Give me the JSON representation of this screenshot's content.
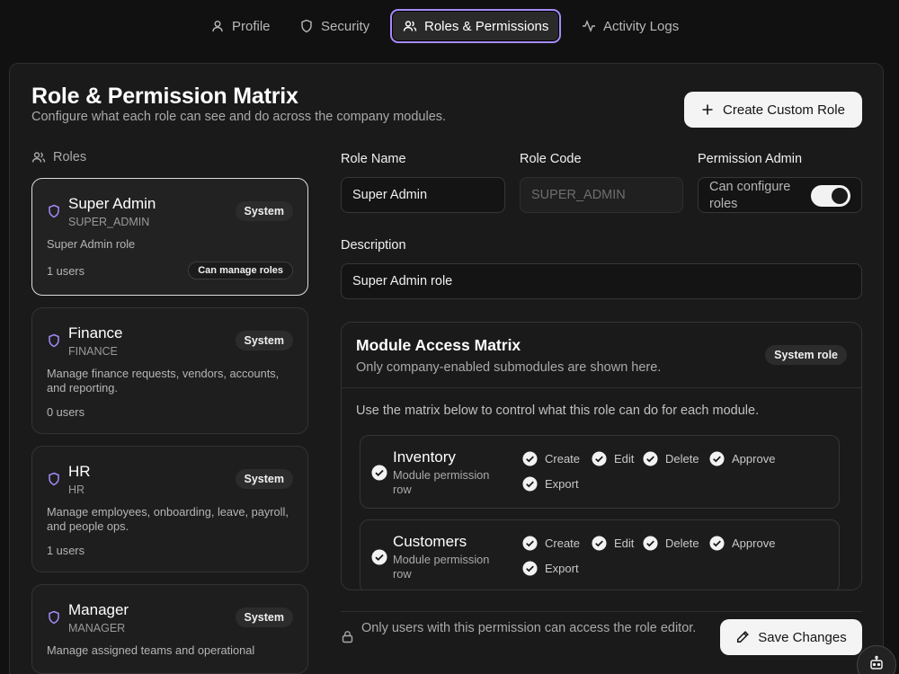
{
  "tabs": [
    {
      "label": "Profile",
      "icon": "user-icon"
    },
    {
      "label": "Security",
      "icon": "shield-icon"
    },
    {
      "label": "Roles & Permissions",
      "icon": "users-icon",
      "active": true
    },
    {
      "label": "Activity Logs",
      "icon": "activity-icon"
    }
  ],
  "header": {
    "title": "Role & Permission Matrix",
    "subtitle": "Configure what each role can see and do across the company modules.",
    "create_label": "Create Custom Role"
  },
  "roles_section": {
    "heading": "Roles",
    "items": [
      {
        "name": "Super Admin",
        "code": "SUPER_ADMIN",
        "badge": "System",
        "description": "Super Admin role",
        "users": "1 users",
        "manage_label": "Can manage roles",
        "selected": true
      },
      {
        "name": "Finance",
        "code": "FINANCE",
        "badge": "System",
        "description": "Manage finance requests, vendors, accounts, and reporting.",
        "users": "0 users"
      },
      {
        "name": "HR",
        "code": "HR",
        "badge": "System",
        "description": "Manage employees, onboarding, leave, payroll, and people ops.",
        "users": "1 users"
      },
      {
        "name": "Manager",
        "code": "MANAGER",
        "badge": "System",
        "description": "Manage assigned teams and operational",
        "users": ""
      }
    ]
  },
  "form": {
    "role_name_label": "Role Name",
    "role_name_value": "Super Admin",
    "role_code_label": "Role Code",
    "role_code_placeholder": "SUPER_ADMIN",
    "permission_admin_label": "Permission Admin",
    "permission_admin_text": "Can configure roles",
    "permission_admin_enabled": true,
    "description_label": "Description",
    "description_value": "Super Admin role"
  },
  "matrix": {
    "title": "Module Access Matrix",
    "subtitle": "Only company-enabled submodules are shown here.",
    "badge": "System role",
    "help": "Use the matrix below to control what this role can do for each module.",
    "modules": [
      {
        "name": "Inventory",
        "subtitle": "Module permission row",
        "permissions": [
          "Create",
          "Edit",
          "Delete",
          "Approve",
          "Export"
        ]
      },
      {
        "name": "Customers",
        "subtitle": "Module permission row",
        "permissions": [
          "Create",
          "Edit",
          "Delete",
          "Approve",
          "Export"
        ]
      }
    ]
  },
  "footer": {
    "note": "Only users with this permission can access the role editor.",
    "save_label": "Save Changes"
  },
  "colors": {
    "background": "#111111",
    "card": "#1a1a1a",
    "accent": "#a78bfa",
    "button": "#f4f4f4"
  }
}
